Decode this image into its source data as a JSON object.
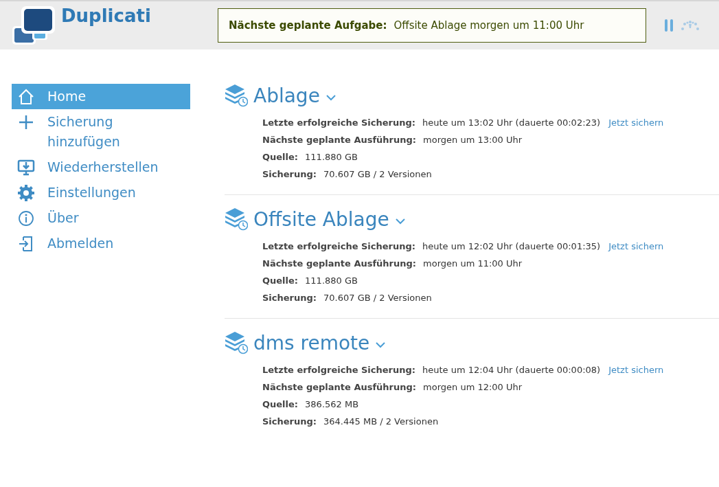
{
  "app": {
    "title": "Duplicati"
  },
  "notice": {
    "label": "Nächste geplante Aufgabe:",
    "value": "Offsite Ablage morgen um 11:00 Uhr"
  },
  "sidebar": {
    "items": [
      {
        "label": "Home",
        "kind": "home",
        "selected": true
      },
      {
        "label": "Sicherung hinzufügen",
        "kind": "add",
        "selected": false
      },
      {
        "label": "Wiederherstellen",
        "kind": "restore",
        "selected": false
      },
      {
        "label": "Einstellungen",
        "kind": "settings",
        "selected": false
      },
      {
        "label": "Über",
        "kind": "about",
        "selected": false
      },
      {
        "label": "Abmelden",
        "kind": "logout",
        "selected": false
      }
    ]
  },
  "backups": [
    {
      "name": "Ablage",
      "rows": [
        {
          "label": "Letzte erfolgreiche Sicherung:",
          "value": "heute um 13:02 Uhr (dauerte 00:02:23)",
          "link": "Jetzt sichern"
        },
        {
          "label": "Nächste geplante Ausführung:",
          "value": "morgen um 13:00 Uhr"
        },
        {
          "label": "Quelle:",
          "value": "111.880 GB"
        },
        {
          "label": "Sicherung:",
          "value": "70.607 GB / 2 Versionen"
        }
      ]
    },
    {
      "name": "Offsite Ablage",
      "rows": [
        {
          "label": "Letzte erfolgreiche Sicherung:",
          "value": "heute um 12:02 Uhr (dauerte 00:01:35)",
          "link": "Jetzt sichern"
        },
        {
          "label": "Nächste geplante Ausführung:",
          "value": "morgen um 11:00 Uhr"
        },
        {
          "label": "Quelle:",
          "value": "111.880 GB"
        },
        {
          "label": "Sicherung:",
          "value": "70.607 GB / 2 Versionen"
        }
      ]
    },
    {
      "name": "dms remote",
      "rows": [
        {
          "label": "Letzte erfolgreiche Sicherung:",
          "value": "heute um 12:04 Uhr (dauerte 00:00:08)",
          "link": "Jetzt sichern"
        },
        {
          "label": "Nächste geplante Ausführung:",
          "value": "morgen um 12:00 Uhr"
        },
        {
          "label": "Quelle:",
          "value": "386.562 MB"
        },
        {
          "label": "Sicherung:",
          "value": "364.445 MB / 2 Versionen"
        }
      ]
    }
  ]
}
